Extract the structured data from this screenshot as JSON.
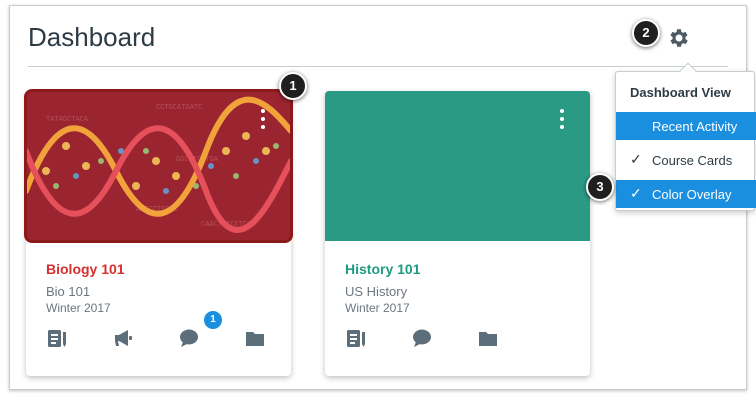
{
  "page_title": "Dashboard",
  "icons": {
    "gear": "gear-icon",
    "kebab": "kebab-menu-icon",
    "announcements": "megaphone-icon",
    "assignments": "assignments-icon",
    "discussions": "discussion-icon",
    "files": "folder-icon",
    "check": "checkmark-icon"
  },
  "callouts": [
    "1",
    "2",
    "3"
  ],
  "courses": [
    {
      "name": "Biology 101",
      "code": "Bio 101",
      "term": "Winter 2017",
      "color": "#d62f2f",
      "hero_color": "#9a2430",
      "discussion_badge": "1"
    },
    {
      "name": "History 101",
      "code": "US History",
      "term": "Winter 2017",
      "color": "#1f9b80",
      "hero_color": "#2a9a85"
    }
  ],
  "dashboard_menu": {
    "header": "Dashboard View",
    "items": [
      {
        "label": "Recent Activity",
        "checked": false,
        "highlighted": true
      },
      {
        "label": "Course Cards",
        "checked": true,
        "highlighted": false
      },
      {
        "label": "Color Overlay",
        "checked": true,
        "highlighted": true
      }
    ]
  },
  "colors": {
    "accent": "#1a8fe0",
    "text": "#2d3b45",
    "muted": "#6b7780",
    "icon": "#5c6e7a"
  }
}
